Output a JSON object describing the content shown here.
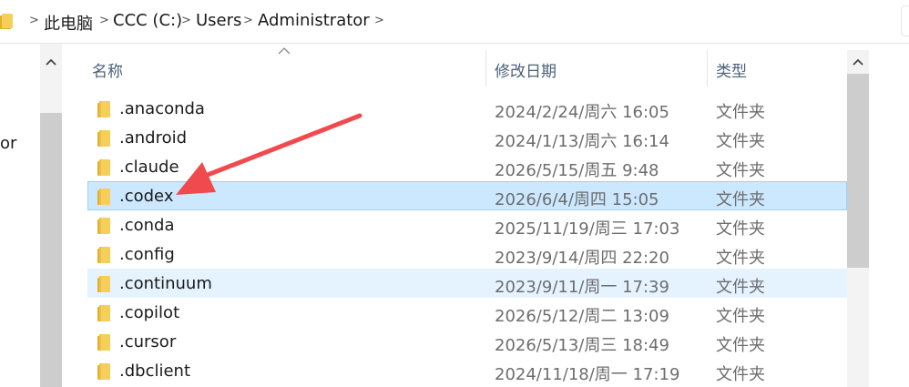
{
  "breadcrumb": [
    "此电脑",
    "CCC (C:)",
    "Users",
    "Administrator"
  ],
  "nav": {
    "partial_label": "or"
  },
  "columns": {
    "name": "名称",
    "date": "修改日期",
    "type": "类型"
  },
  "files": [
    {
      "name": ".anaconda",
      "date": "2024/2/24/周六 16:05",
      "type": "文件夹",
      "state": ""
    },
    {
      "name": ".android",
      "date": "2024/1/13/周六 16:14",
      "type": "文件夹",
      "state": ""
    },
    {
      "name": ".claude",
      "date": "2026/5/15/周五 9:48",
      "type": "文件夹",
      "state": ""
    },
    {
      "name": ".codex",
      "date": "2026/6/4/周四 15:05",
      "type": "文件夹",
      "state": "selected"
    },
    {
      "name": ".conda",
      "date": "2025/11/19/周三 17:03",
      "type": "文件夹",
      "state": ""
    },
    {
      "name": ".config",
      "date": "2023/9/14/周四 22:20",
      "type": "文件夹",
      "state": ""
    },
    {
      "name": ".continuum",
      "date": "2023/9/11/周一 17:39",
      "type": "文件夹",
      "state": "hover"
    },
    {
      "name": ".copilot",
      "date": "2026/5/12/周二 13:09",
      "type": "文件夹",
      "state": ""
    },
    {
      "name": ".cursor",
      "date": "2026/5/13/周三 18:49",
      "type": "文件夹",
      "state": ""
    },
    {
      "name": ".dbclient",
      "date": "2024/11/18/周一 17:19",
      "type": "文件夹",
      "state": ""
    }
  ],
  "colors": {
    "selected_bg": "#cce8ff",
    "selected_border": "#99d1ff",
    "hover_bg": "#e5f3ff",
    "folder": "#f2c44e",
    "annotation_arrow": "#f04a4f"
  },
  "icons": {
    "folder": "folder-icon",
    "chevron": "chevron-right-icon",
    "scroll_up": "caret-up-icon",
    "sort": "sort-caret-up-icon"
  }
}
